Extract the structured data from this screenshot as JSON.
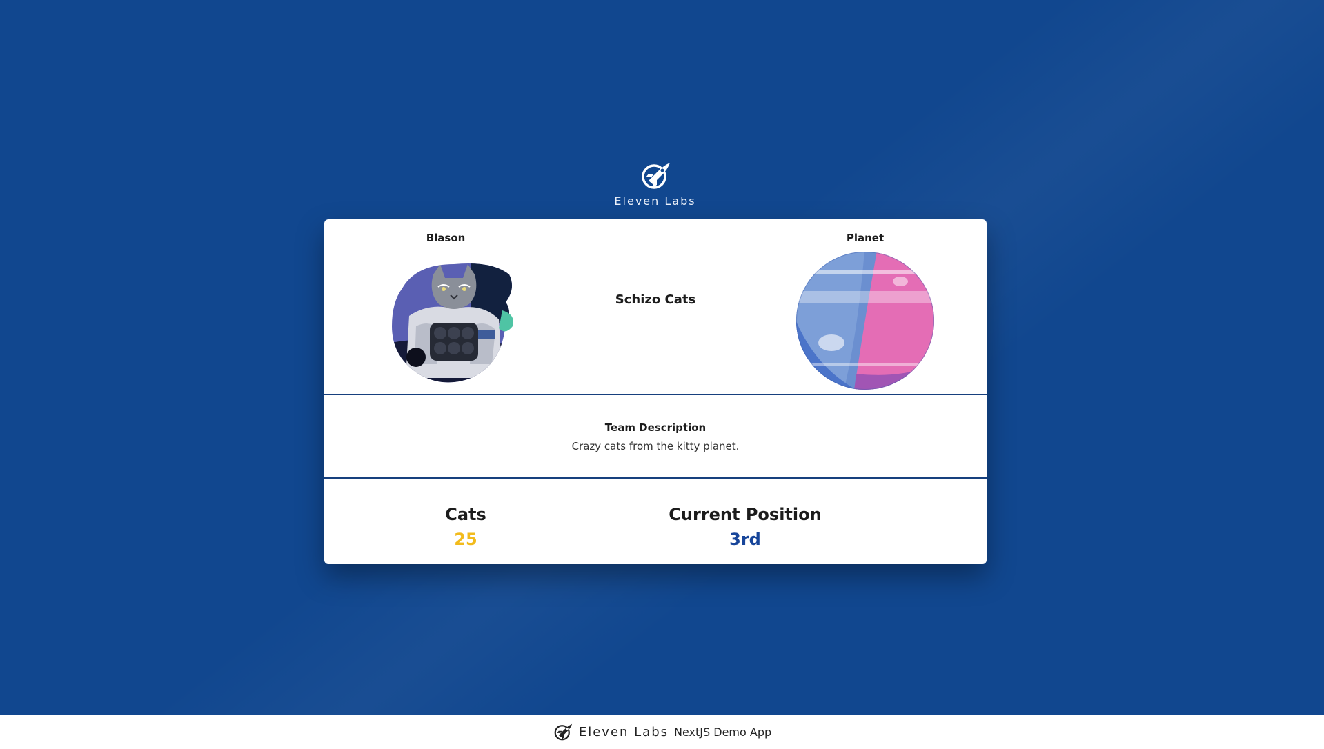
{
  "header": {
    "logo_icon": "rocket-logo-icon",
    "brand": "Eleven Labs"
  },
  "team": {
    "blason_label": "Blason",
    "blason_image": "astronaut-cat-image",
    "name": "Schizo Cats",
    "planet_label": "Planet",
    "planet_image": "pink-blue-planet-image",
    "description_title": "Team Description",
    "description": "Crazy cats from the kitty planet."
  },
  "stats": {
    "cats_label": "Cats",
    "cats_value": "25",
    "position_label": "Current Position",
    "position_value": "3rd"
  },
  "footer": {
    "brand": "Eleven Labs",
    "subtitle": "NextJS Demo App"
  },
  "colors": {
    "background": "#11478f",
    "card": "#ffffff",
    "divider": "#17407e",
    "cats_value": "#f2bb1c",
    "position_value": "#17459a"
  }
}
